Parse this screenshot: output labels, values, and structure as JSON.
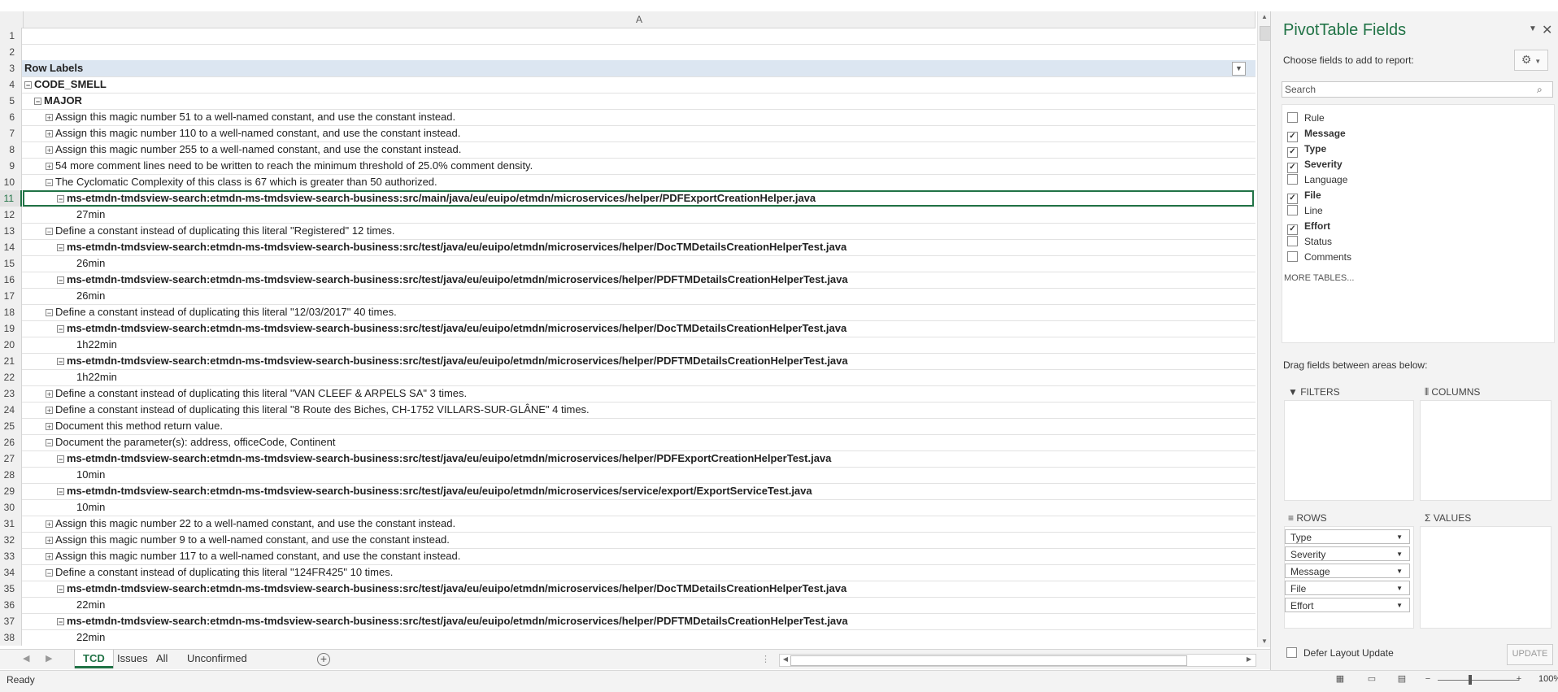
{
  "sheet": {
    "column_header": "A",
    "rows": [
      {
        "n": "1",
        "text": "",
        "level": 0,
        "toggle": "",
        "bold": false
      },
      {
        "n": "2",
        "text": "",
        "level": 0,
        "toggle": "",
        "bold": false
      },
      {
        "n": "3",
        "text": "Row Labels",
        "level": 0,
        "toggle": "",
        "bold": true,
        "header": true
      },
      {
        "n": "4",
        "text": "CODE_SMELL",
        "level": 0,
        "toggle": "minus",
        "bold": true
      },
      {
        "n": "5",
        "text": "MAJOR",
        "level": 1,
        "toggle": "minus",
        "bold": true
      },
      {
        "n": "6",
        "text": "Assign this magic number 51 to a well-named constant, and use the constant instead.",
        "level": 2,
        "toggle": "plus",
        "bold": false
      },
      {
        "n": "7",
        "text": "Assign this magic number 110 to a well-named constant, and use the constant instead.",
        "level": 2,
        "toggle": "plus",
        "bold": false
      },
      {
        "n": "8",
        "text": "Assign this magic number 255 to a well-named constant, and use the constant instead.",
        "level": 2,
        "toggle": "plus",
        "bold": false
      },
      {
        "n": "9",
        "text": "54 more comment lines need to be written to reach the minimum threshold of 25.0% comment density.",
        "level": 2,
        "toggle": "plus",
        "bold": false
      },
      {
        "n": "10",
        "text": "The Cyclomatic Complexity of this class is 67 which is greater than 50 authorized.",
        "level": 2,
        "toggle": "minus",
        "bold": false
      },
      {
        "n": "11",
        "text": "ms-etmdn-tmdsview-search:etmdn-ms-tmdsview-search-business:src/main/java/eu/euipo/etmdn/microservices/helper/PDFExportCreationHelper.java",
        "level": 3,
        "toggle": "minus",
        "bold": true,
        "selected": true
      },
      {
        "n": "12",
        "text": "27min",
        "level": 4,
        "toggle": "",
        "bold": false
      },
      {
        "n": "13",
        "text": "Define a constant instead of duplicating this literal \"Registered\" 12 times.",
        "level": 2,
        "toggle": "minus",
        "bold": false
      },
      {
        "n": "14",
        "text": "ms-etmdn-tmdsview-search:etmdn-ms-tmdsview-search-business:src/test/java/eu/euipo/etmdn/microservices/helper/DocTMDetailsCreationHelperTest.java",
        "level": 3,
        "toggle": "minus",
        "bold": true
      },
      {
        "n": "15",
        "text": "26min",
        "level": 4,
        "toggle": "",
        "bold": false
      },
      {
        "n": "16",
        "text": "ms-etmdn-tmdsview-search:etmdn-ms-tmdsview-search-business:src/test/java/eu/euipo/etmdn/microservices/helper/PDFTMDetailsCreationHelperTest.java",
        "level": 3,
        "toggle": "minus",
        "bold": true
      },
      {
        "n": "17",
        "text": "26min",
        "level": 4,
        "toggle": "",
        "bold": false
      },
      {
        "n": "18",
        "text": "Define a constant instead of duplicating this literal \"12/03/2017\" 40 times.",
        "level": 2,
        "toggle": "minus",
        "bold": false
      },
      {
        "n": "19",
        "text": "ms-etmdn-tmdsview-search:etmdn-ms-tmdsview-search-business:src/test/java/eu/euipo/etmdn/microservices/helper/DocTMDetailsCreationHelperTest.java",
        "level": 3,
        "toggle": "minus",
        "bold": true
      },
      {
        "n": "20",
        "text": "1h22min",
        "level": 4,
        "toggle": "",
        "bold": false
      },
      {
        "n": "21",
        "text": "ms-etmdn-tmdsview-search:etmdn-ms-tmdsview-search-business:src/test/java/eu/euipo/etmdn/microservices/helper/PDFTMDetailsCreationHelperTest.java",
        "level": 3,
        "toggle": "minus",
        "bold": true
      },
      {
        "n": "22",
        "text": "1h22min",
        "level": 4,
        "toggle": "",
        "bold": false
      },
      {
        "n": "23",
        "text": "Define a constant instead of duplicating this literal \"VAN CLEEF & ARPELS SA\" 3 times.",
        "level": 2,
        "toggle": "plus",
        "bold": false
      },
      {
        "n": "24",
        "text": "Define a constant instead of duplicating this literal \"8 Route des Biches, CH-1752 VILLARS-SUR-GLÂNE\" 4 times.",
        "level": 2,
        "toggle": "plus",
        "bold": false
      },
      {
        "n": "25",
        "text": "Document this method return value.",
        "level": 2,
        "toggle": "plus",
        "bold": false
      },
      {
        "n": "26",
        "text": "Document the parameter(s): address, officeCode, Continent",
        "level": 2,
        "toggle": "minus",
        "bold": false
      },
      {
        "n": "27",
        "text": "ms-etmdn-tmdsview-search:etmdn-ms-tmdsview-search-business:src/test/java/eu/euipo/etmdn/microservices/helper/PDFExportCreationHelperTest.java",
        "level": 3,
        "toggle": "minus",
        "bold": true
      },
      {
        "n": "28",
        "text": "10min",
        "level": 4,
        "toggle": "",
        "bold": false
      },
      {
        "n": "29",
        "text": "ms-etmdn-tmdsview-search:etmdn-ms-tmdsview-search-business:src/test/java/eu/euipo/etmdn/microservices/service/export/ExportServiceTest.java",
        "level": 3,
        "toggle": "minus",
        "bold": true
      },
      {
        "n": "30",
        "text": "10min",
        "level": 4,
        "toggle": "",
        "bold": false
      },
      {
        "n": "31",
        "text": "Assign this magic number 22 to a well-named constant, and use the constant instead.",
        "level": 2,
        "toggle": "plus",
        "bold": false
      },
      {
        "n": "32",
        "text": "Assign this magic number 9 to a well-named constant, and use the constant instead.",
        "level": 2,
        "toggle": "plus",
        "bold": false
      },
      {
        "n": "33",
        "text": "Assign this magic number 117 to a well-named constant, and use the constant instead.",
        "level": 2,
        "toggle": "plus",
        "bold": false
      },
      {
        "n": "34",
        "text": "Define a constant instead of duplicating this literal \"124FR425\" 10 times.",
        "level": 2,
        "toggle": "minus",
        "bold": false
      },
      {
        "n": "35",
        "text": "ms-etmdn-tmdsview-search:etmdn-ms-tmdsview-search-business:src/test/java/eu/euipo/etmdn/microservices/helper/DocTMDetailsCreationHelperTest.java",
        "level": 3,
        "toggle": "minus",
        "bold": true
      },
      {
        "n": "36",
        "text": "22min",
        "level": 4,
        "toggle": "",
        "bold": false
      },
      {
        "n": "37",
        "text": "ms-etmdn-tmdsview-search:etmdn-ms-tmdsview-search-business:src/test/java/eu/euipo/etmdn/microservices/helper/PDFTMDetailsCreationHelperTest.java",
        "level": 3,
        "toggle": "minus",
        "bold": true
      },
      {
        "n": "38",
        "text": "22min",
        "level": 4,
        "toggle": "",
        "bold": false
      }
    ]
  },
  "tabs": [
    {
      "label": "TCD",
      "active": true
    },
    {
      "label": "Issues",
      "active": false
    },
    {
      "label": "All",
      "active": false
    },
    {
      "label": "Unconfirmed",
      "active": false
    }
  ],
  "status": {
    "text": "Ready",
    "zoom": "100%"
  },
  "pivot": {
    "title": "PivotTable Fields",
    "choose": "Choose fields to add to report:",
    "search_placeholder": "Search",
    "fields": [
      {
        "label": "Rule",
        "checked": false
      },
      {
        "label": "Message",
        "checked": true
      },
      {
        "label": "Type",
        "checked": true
      },
      {
        "label": "Severity",
        "checked": true
      },
      {
        "label": "Language",
        "checked": false
      },
      {
        "label": "File",
        "checked": true
      },
      {
        "label": "Line",
        "checked": false
      },
      {
        "label": "Effort",
        "checked": true
      },
      {
        "label": "Status",
        "checked": false
      },
      {
        "label": "Comments",
        "checked": false
      }
    ],
    "more_tables": "MORE TABLES...",
    "drag_text": "Drag fields between areas below:",
    "areas": {
      "filters": "FILTERS",
      "columns": "COLUMNS",
      "rows": "ROWS",
      "values": "VALUES"
    },
    "row_fields": [
      "Type",
      "Severity",
      "Message",
      "File",
      "Effort"
    ],
    "defer": "Defer Layout Update",
    "update": "UPDATE"
  }
}
